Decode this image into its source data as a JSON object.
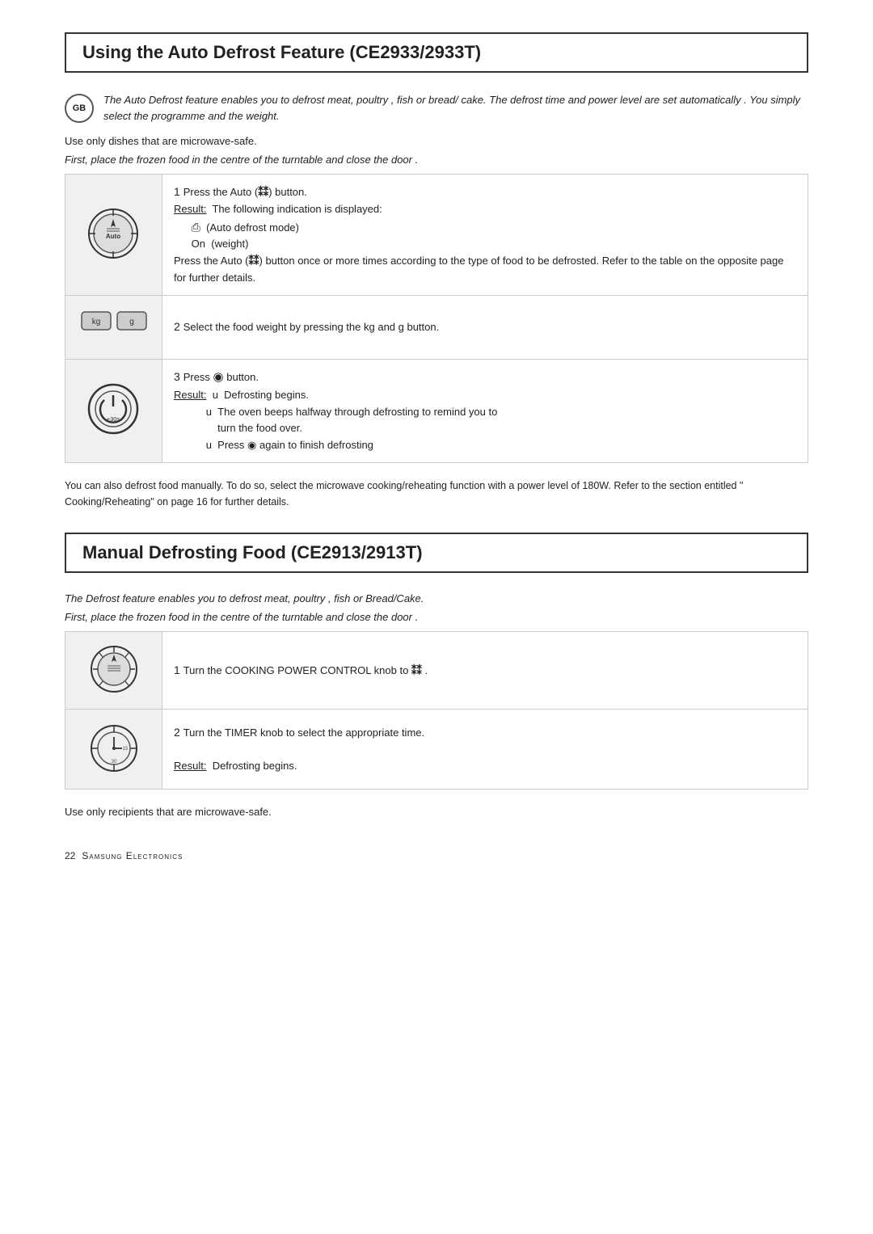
{
  "page": {
    "section1": {
      "title": "Using the  Auto Defrost Feature (CE2933/2933T)",
      "gb_badge": "GB",
      "intro_text": "The Auto Defrost feature enables you to defrost meat, poultry      , fish or bread/ cake. The defrost time and power level are set automatically      . You simply select the programme and the weight.",
      "note": "Use only dishes that are microwave-safe.",
      "placement": "First, place the frozen food in the centre of the turntable and close the door      .",
      "steps": [
        {
          "step_num": "1",
          "icon_type": "auto-knob",
          "text": "Press the Auto (  ) button.",
          "result_label": "Result:",
          "result_lines": [
            "The following indication is displayed:",
            "   (Auto defrost mode)",
            "On  (weight)",
            "Press the Auto (  ) button once or more times according to the type of food to be defrosted. Refer to the table on the opposite page for further details."
          ]
        },
        {
          "step_num": "2",
          "icon_type": "kg-g",
          "text": "Select the food weight by pressing the kg and g button.",
          "result_label": "",
          "result_lines": []
        },
        {
          "step_num": "3",
          "icon_type": "start-button",
          "text": "Press   button.",
          "result_label": "Result:",
          "result_lines": [
            "u  Defrosting begins.",
            "u  The oven beeps halfway through defrosting to remind you to turn the food over.",
            "u  Press   again to finish defrosting"
          ]
        }
      ],
      "manual_defrost_note": "You can also defrost food manually. To do so, select the microwave cooking/reheating function with a power level of 180W. Refer to the section entitled \" Cooking/Reheating\" on page 16 for further details."
    },
    "section2": {
      "title": "Manual Defrosting Food (CE2913/2913T)",
      "intro_text": "The Defrost feature enables you to defrost meat, poultry      , fish or Bread/Cake.",
      "placement": "First, place the frozen food in the centre of the turntable and close the door      .",
      "steps": [
        {
          "step_num": "1",
          "icon_type": "power-knob",
          "text": "Turn the COOKING POWER CONTROL knob to   ."
        },
        {
          "step_num": "2",
          "icon_type": "timer-knob",
          "text": "Turn the TIMER knob to select the appropriate time.",
          "result_label": "Result:",
          "result_text": "Defrosting begins."
        }
      ],
      "footer_note": "Use only recipients that are microwave-safe."
    },
    "footer": {
      "page_number": "22",
      "brand": "Samsung Electronics"
    }
  }
}
